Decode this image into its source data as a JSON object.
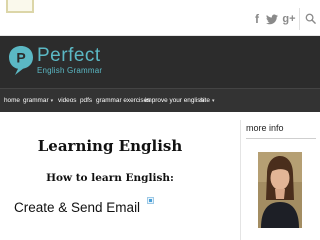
{
  "header": {
    "logo": {
      "title": "Perfect",
      "subtitle": "English Grammar",
      "badge_letter": "P",
      "color": "#5bb8c4"
    }
  },
  "social": {
    "facebook": "f",
    "twitter": "🐦",
    "google_plus": "g+"
  },
  "nav": {
    "items": [
      {
        "label": "home"
      },
      {
        "label": "grammar",
        "caret": "▾"
      },
      {
        "label": "videos"
      },
      {
        "label": "pdfs"
      },
      {
        "label": "grammar exercises"
      },
      {
        "label": "improve your english"
      },
      {
        "label": "site",
        "caret": "▾"
      }
    ]
  },
  "main": {
    "title": "Learning English",
    "subtitle": "How to learn English:",
    "ad_text": "Create & Send Email"
  },
  "sidebar": {
    "title": "more info"
  },
  "colors": {
    "header_bg": "#2c2c2c",
    "nav_bg": "#333333",
    "accent": "#5bb8c4"
  }
}
